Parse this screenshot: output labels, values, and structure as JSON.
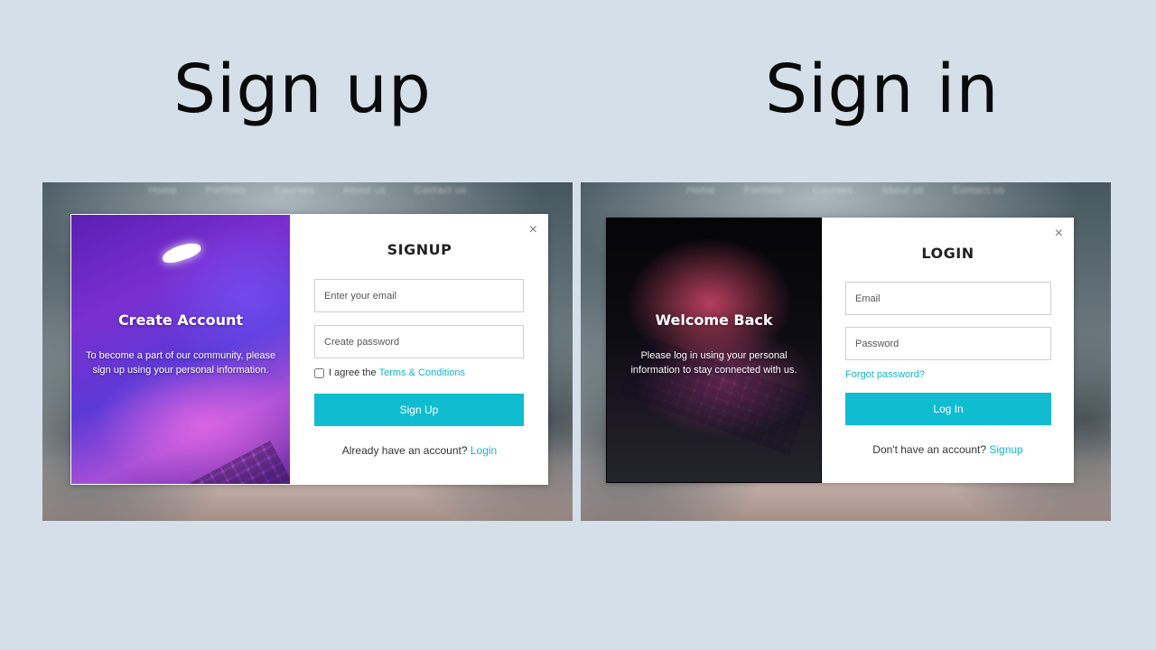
{
  "headings": {
    "signup": "Sign up",
    "signin": "Sign in"
  },
  "nav": [
    "Home",
    "Portfolio",
    "Courses",
    "About us",
    "Contact us"
  ],
  "signup": {
    "image_title": "Create Account",
    "image_text": "To become a part of our community, please sign up using your personal information.",
    "form_title": "SIGNUP",
    "email_placeholder": "Enter your email",
    "password_placeholder": "Create password",
    "agree_text": "I agree the",
    "terms_link": "Terms & Conditions",
    "button": "Sign Up",
    "switch_text": "Already have an account?",
    "switch_link": "Login",
    "close": "×"
  },
  "signin": {
    "image_title": "Welcome Back",
    "image_text": "Please log in using your personal information to stay connected with us.",
    "form_title": "LOGIN",
    "email_placeholder": "Email",
    "password_placeholder": "Password",
    "forgot_link": "Forgot password?",
    "button": "Log In",
    "switch_text": "Don't have an account?",
    "switch_link": "Signup",
    "close": "×"
  },
  "colors": {
    "accent": "#0fbcd0",
    "page_background": "#d4dfe9"
  },
  "icons": {
    "close": "close-icon",
    "logo": "apple-logo"
  }
}
